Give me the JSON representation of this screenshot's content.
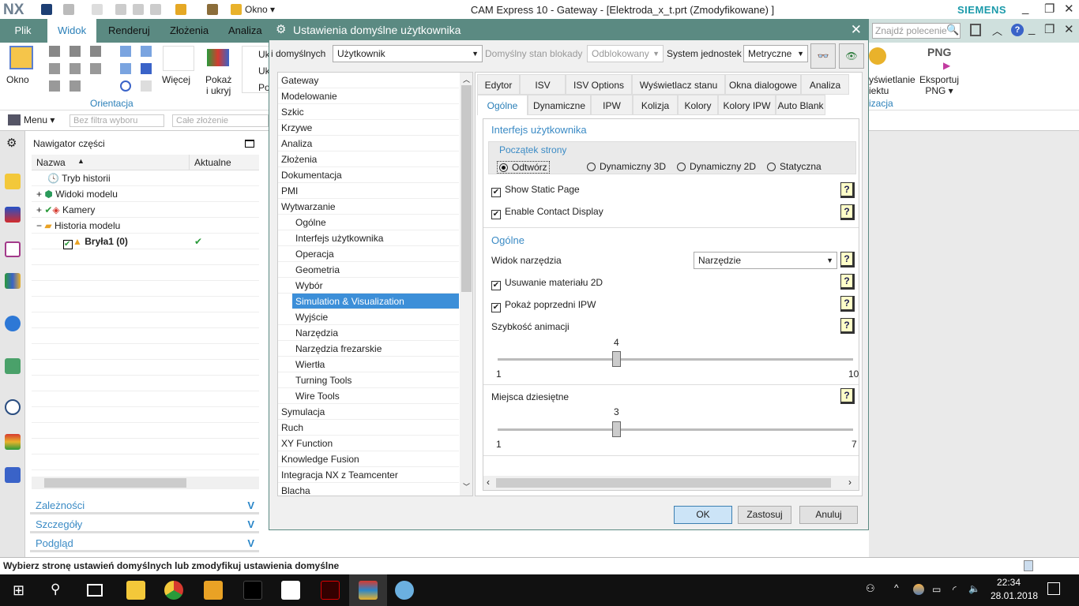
{
  "app": {
    "logo": "NX",
    "title": "CAM Express 10 - Gateway - [Elektroda_x_t.prt (Zmodyfikowane) ]",
    "brand": "SIEMENS",
    "okno_menu": "Okno ▾"
  },
  "ribbon": {
    "tabs": [
      "Plik",
      "Widok",
      "Renderuj",
      "Złożenia",
      "Analiza"
    ],
    "search_placeholder": "Znajdź polecenie",
    "groups": {
      "okno": "Okno",
      "orientacja": "Orientacja",
      "wiecej": "Więcej",
      "pokaz": "Pokaż\ni ukryj",
      "uk1": "Uk",
      "uk2": "Uk",
      "po": "Po",
      "wyswietlanie": "yświetlanie\niektu",
      "eksportuj": "Eksportuj\nPNG ▾",
      "png": "PNG",
      "izacja": "izacja"
    }
  },
  "selbar": {
    "menu": "Menu ▾",
    "filter": "Bez filtra wyboru",
    "scope": "Całe złożenie"
  },
  "navigator": {
    "title": "Nawigator części",
    "columns": [
      "Nazwa",
      "Aktualne"
    ],
    "rows": [
      {
        "name": "Tryb historii",
        "current": ""
      },
      {
        "name": "Widoki modelu",
        "current": ""
      },
      {
        "name": "Kamery",
        "current": ""
      },
      {
        "name": "Historia modelu",
        "current": ""
      },
      {
        "name": "Bryła1 (0)",
        "current": "✔"
      }
    ],
    "panels": [
      "Zależności",
      "Szczegóły",
      "Podgląd"
    ]
  },
  "status": "Wybierz stronę ustawień domyślnych lub zmodyfikuj ustawienia domyślne",
  "taskbar": {
    "time": "22:34",
    "date": "28.01.2018"
  },
  "dialog": {
    "title": "Ustawienia domyślne użytkownika",
    "level_label": "i domyślnych",
    "level_value": "Użytkownik",
    "lock_label": "Domyślny stan blokady",
    "lock_value": "Odblokowany",
    "units_label": "System jednostek",
    "units_value": "Metryczne",
    "categories": [
      {
        "label": "Gateway",
        "level": 0
      },
      {
        "label": "Modelowanie",
        "level": 0
      },
      {
        "label": "Szkic",
        "level": 0
      },
      {
        "label": "Krzywe",
        "level": 0
      },
      {
        "label": "Analiza",
        "level": 0
      },
      {
        "label": "Złożenia",
        "level": 0
      },
      {
        "label": "Dokumentacja",
        "level": 0
      },
      {
        "label": "PMI",
        "level": 0
      },
      {
        "label": "Wytwarzanie",
        "level": 0
      },
      {
        "label": "Ogólne",
        "level": 1
      },
      {
        "label": "Interfejs użytkownika",
        "level": 1
      },
      {
        "label": "Operacja",
        "level": 1
      },
      {
        "label": "Geometria",
        "level": 1
      },
      {
        "label": "Wybór",
        "level": 1
      },
      {
        "label": "Simulation & Visualization",
        "level": 1,
        "selected": true
      },
      {
        "label": "Wyjście",
        "level": 1
      },
      {
        "label": "Narzędzia",
        "level": 1
      },
      {
        "label": "Narzędzia frezarskie",
        "level": 1
      },
      {
        "label": "Wiertła",
        "level": 1
      },
      {
        "label": "Turning Tools",
        "level": 1
      },
      {
        "label": "Wire Tools",
        "level": 1
      },
      {
        "label": "Symulacja",
        "level": 0
      },
      {
        "label": "Ruch",
        "level": 0
      },
      {
        "label": "XY Function",
        "level": 0
      },
      {
        "label": "Knowledge Fusion",
        "level": 0
      },
      {
        "label": "Integracja NX z Teamcenter",
        "level": 0
      },
      {
        "label": "Blacha",
        "level": 0
      }
    ],
    "tabs_row1": [
      "Edytor",
      "ISV",
      "ISV Options",
      "Wyświetlacz stanu",
      "Okna dialogowe",
      "Analiza"
    ],
    "tabs_row2": [
      "Ogólne",
      "Dynamiczne",
      "IPW",
      "Kolizja",
      "Kolory",
      "Kolory IPW",
      "Auto Blank"
    ],
    "active_tab": "Ogólne",
    "ui_section": "Interfejs użytkownika",
    "start_page_label": "Początek strony",
    "start_options": [
      "Odtwórz",
      "Dynamiczny 3D",
      "Dynamiczny 2D",
      "Statyczna"
    ],
    "start_selected": "Odtwórz",
    "show_static": {
      "label": "Show Static Page",
      "checked": true
    },
    "contact_display": {
      "label": "Enable Contact Display",
      "checked": true
    },
    "general_section": "Ogólne",
    "tool_view_label": "Widok narzędzia",
    "tool_view_value": "Narzędzie",
    "remove_2d": {
      "label": "Usuwanie materiału 2D",
      "checked": true
    },
    "prev_ipw": {
      "label": "Pokaż poprzedni IPW",
      "checked": true
    },
    "anim": {
      "label": "Szybkość animacji",
      "value": "4",
      "min": "1",
      "max": "10"
    },
    "decimals": {
      "label": "Miejsca dziesiętne",
      "value": "3",
      "min": "1",
      "max": "7"
    },
    "help": "?",
    "ok": "OK",
    "apply": "Zastosuj",
    "cancel": "Anuluj"
  },
  "colors": {
    "teal": "#5b8a82",
    "accent": "#2a7fb8",
    "selection": "#3c8fd8"
  }
}
